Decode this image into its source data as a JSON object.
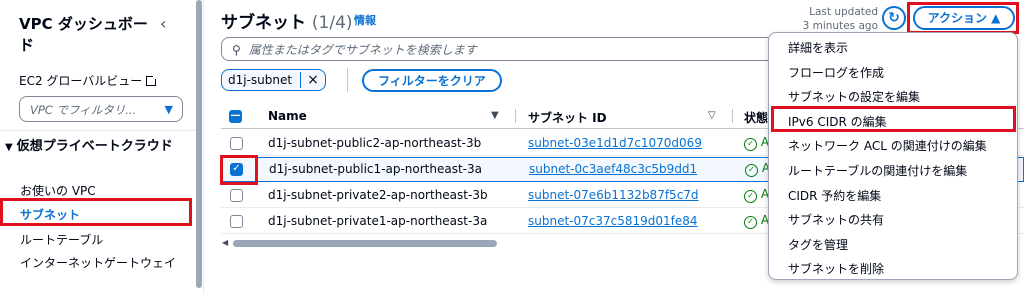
{
  "sidebar": {
    "title": "VPC ダッシュボード",
    "close_icon": "chevron-left-icon",
    "global_view_link": "EC2 グローバルビュー",
    "filter_placeholder": "VPC でフィルタリ...",
    "section_title": "仮想プライベートクラウド",
    "items": [
      {
        "label": "お使いの VPC"
      },
      {
        "label": "サブネット",
        "active": true
      },
      {
        "label": "ルートテーブル"
      },
      {
        "label": "インターネットゲートウェイ"
      }
    ]
  },
  "header": {
    "title": "サブネット",
    "count": "(1/4)",
    "info": "情報",
    "last_updated": "Last updated",
    "last_updated_ago": "3 minutes ago",
    "refresh_icon": "refresh-icon",
    "actions_label": "アクション ▲"
  },
  "search": {
    "placeholder": "属性またはタグでサブネットを検索します"
  },
  "filter": {
    "token": "d1j-subnet",
    "clear_label": "フィルターをクリア"
  },
  "table": {
    "columns": [
      "Name",
      "サブネット ID",
      "状態"
    ],
    "rows": [
      {
        "name": "d1j-subnet-public2-ap-northeast-3b",
        "id": "subnet-03e1d1d7c1070d069",
        "state": "A",
        "checked": false
      },
      {
        "name": "d1j-subnet-public1-ap-northeast-3a",
        "id": "subnet-0c3aef48c3c5b9dd1",
        "state": "A",
        "checked": true
      },
      {
        "name": "d1j-subnet-private2-ap-northeast-3b",
        "id": "subnet-07e6b1132b87f5c7d",
        "state": "A",
        "checked": false
      },
      {
        "name": "d1j-subnet-private1-ap-northeast-3a",
        "id": "subnet-07c37c5819d01fe84",
        "state": "A",
        "checked": false
      }
    ]
  },
  "actions_menu": {
    "items": [
      {
        "label": "詳細を表示"
      },
      {
        "label": "フローログを作成"
      },
      {
        "label": "サブネットの設定を編集"
      },
      {
        "label": "IPv6 CIDR の編集",
        "highlighted": true
      },
      {
        "label": "ネットワーク ACL の関連付けの編集"
      },
      {
        "label": "ルートテーブルの関連付けを編集"
      },
      {
        "label": "CIDR 予約を編集"
      },
      {
        "label": "サブネットの共有"
      },
      {
        "label": "タグを管理"
      },
      {
        "label": "サブネットを削除"
      }
    ]
  },
  "colors": {
    "accent": "#0972d3",
    "highlight_box": "#e0101f",
    "status_ok": "#037f0c"
  }
}
